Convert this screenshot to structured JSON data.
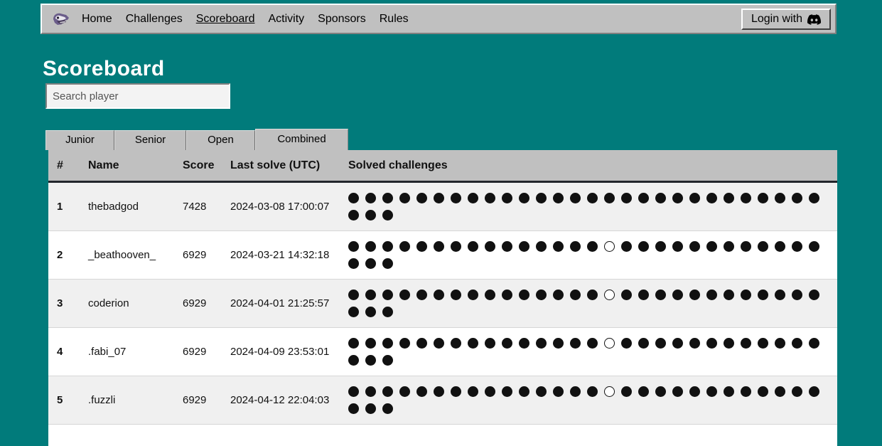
{
  "theme": {
    "background": "#017b7b",
    "chrome": "#c0c0c0",
    "text": "#111111",
    "row_odd": "#f0f0f0",
    "row_even": "#ffffff"
  },
  "nav": {
    "logo_alt": "dinosaur-logo",
    "items": [
      {
        "label": "Home",
        "active": false
      },
      {
        "label": "Challenges",
        "active": false
      },
      {
        "label": "Scoreboard",
        "active": true
      },
      {
        "label": "Activity",
        "active": false
      },
      {
        "label": "Sponsors",
        "active": false
      },
      {
        "label": "Rules",
        "active": false
      }
    ],
    "login": {
      "label": "Login with",
      "icon": "discord-icon"
    }
  },
  "page": {
    "title": "Scoreboard"
  },
  "search": {
    "placeholder": "Search player",
    "value": ""
  },
  "tabs": [
    {
      "label": "Junior",
      "active": false,
      "width": 97
    },
    {
      "label": "Senior",
      "active": false,
      "width": 101
    },
    {
      "label": "Open",
      "active": false,
      "width": 97
    },
    {
      "label": "Combined",
      "active": true,
      "width": 131
    }
  ],
  "table": {
    "columns": [
      "#",
      "Name",
      "Score",
      "Last solve (UTC)",
      "Solved challenges"
    ],
    "rows": [
      {
        "rank": "1",
        "name": "thebadgod",
        "score": "7428",
        "last_solve": "2024-03-08 17:00:07",
        "solved": [
          1,
          1,
          1,
          1,
          1,
          1,
          1,
          1,
          1,
          1,
          1,
          1,
          1,
          1,
          1,
          1,
          1,
          1,
          1,
          1,
          1,
          1,
          1,
          1,
          1,
          1,
          1,
          1,
          1,
          1,
          1
        ]
      },
      {
        "rank": "2",
        "name": "_beathooven_",
        "score": "6929",
        "last_solve": "2024-03-21 14:32:18",
        "solved": [
          1,
          1,
          1,
          1,
          1,
          1,
          1,
          1,
          1,
          1,
          1,
          1,
          1,
          1,
          1,
          0,
          1,
          1,
          1,
          1,
          1,
          1,
          1,
          1,
          1,
          1,
          1,
          1,
          1,
          1,
          1
        ]
      },
      {
        "rank": "3",
        "name": "coderion",
        "score": "6929",
        "last_solve": "2024-04-01 21:25:57",
        "solved": [
          1,
          1,
          1,
          1,
          1,
          1,
          1,
          1,
          1,
          1,
          1,
          1,
          1,
          1,
          1,
          0,
          1,
          1,
          1,
          1,
          1,
          1,
          1,
          1,
          1,
          1,
          1,
          1,
          1,
          1,
          1
        ]
      },
      {
        "rank": "4",
        "name": ".fabi_07",
        "score": "6929",
        "last_solve": "2024-04-09 23:53:01",
        "solved": [
          1,
          1,
          1,
          1,
          1,
          1,
          1,
          1,
          1,
          1,
          1,
          1,
          1,
          1,
          1,
          0,
          1,
          1,
          1,
          1,
          1,
          1,
          1,
          1,
          1,
          1,
          1,
          1,
          1,
          1,
          1
        ]
      },
      {
        "rank": "5",
        "name": ".fuzzli",
        "score": "6929",
        "last_solve": "2024-04-12 22:04:03",
        "solved": [
          1,
          1,
          1,
          1,
          1,
          1,
          1,
          1,
          1,
          1,
          1,
          1,
          1,
          1,
          1,
          0,
          1,
          1,
          1,
          1,
          1,
          1,
          1,
          1,
          1,
          1,
          1,
          1,
          1,
          1,
          1
        ]
      }
    ]
  }
}
